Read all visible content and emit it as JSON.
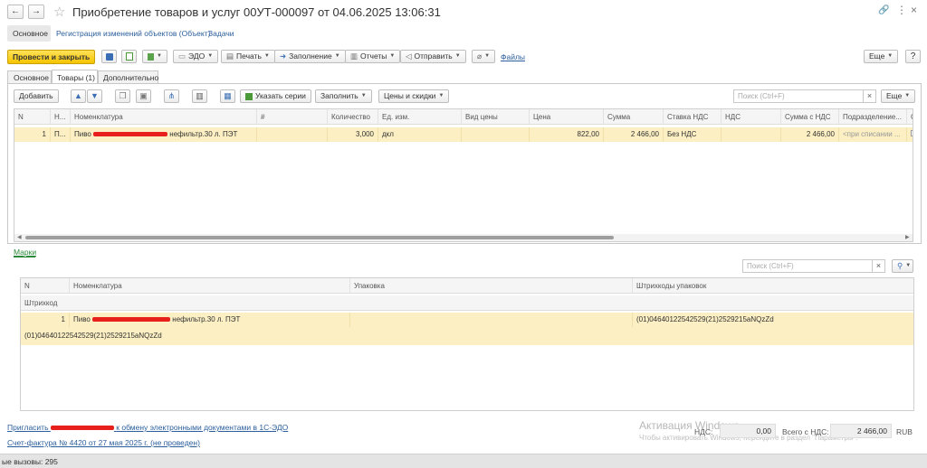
{
  "window": {
    "title": "Приобретение товаров и услуг 00УТ-000097 от 04.06.2025 13:06:31"
  },
  "nav_tabs": [
    "Основное",
    "Регистрация изменений объектов (Объект)",
    "Задачи"
  ],
  "toolbar": {
    "post_close": "Провести и закрыть",
    "edo": "ЭДО",
    "print": "Печать",
    "fill": "Заполнение",
    "reports": "Отчеты",
    "send": "Отправить",
    "files": "Файлы",
    "more": "Еще"
  },
  "form_tabs": [
    "Основное",
    "Товары (1)",
    "Дополнительно"
  ],
  "goods_toolbar": {
    "add": "Добавить",
    "specify_series": "Указать серии",
    "fill": "Заполнить",
    "prices": "Цены и скидки",
    "search_placeholder": "Поиск (Ctrl+F)",
    "more": "Еще"
  },
  "goods_table": {
    "headers": [
      "N",
      "Н...",
      "Номенклатура",
      "#",
      "Количество",
      "Ед. изм.",
      "Вид цены",
      "Цена",
      "Сумма",
      "Ставка НДС",
      "НДС",
      "Сумма с НДС",
      "Подразделение...",
      "С"
    ],
    "rows": [
      {
        "n": "1",
        "h": "П...",
        "nomenclature_prefix": "Пиво",
        "nomenclature_suffix": "нефильтр.30 л. ПЭТ",
        "qty": "3,000",
        "unit": "дкл",
        "price_type": "",
        "price": "822,00",
        "sum": "2 466,00",
        "vat_rate": "Без НДС",
        "vat": "",
        "sum_vat": "2 466,00",
        "division": "<при списании ..."
      }
    ]
  },
  "marks_link": "Марки",
  "marks_search_placeholder": "Поиск (Ctrl+F)",
  "marks_table": {
    "headers": [
      "N",
      "Номенклатура",
      "Упаковка",
      "Штрихкоды упаковок"
    ],
    "subheader": "Штрихкод",
    "row": {
      "n": "1",
      "nomenclature_prefix": "Пиво",
      "nomenclature_suffix": "нефильтр.30 л. ПЭТ",
      "pack_barcodes": "(01)04640122542529(21)2529215aNQzZd"
    },
    "barcode": "(01)04640122542529(21)2529215aNQzZd"
  },
  "footer": {
    "invite_prefix": "Пригласить",
    "invite_suffix": "к обмену электронными документами в 1С-ЭДО",
    "invoice": "Счет-фактура № 4420 от 27 мая 2025 г. (не проведен)",
    "vat_label": "НДС:",
    "vat_value": "0,00",
    "total_label": "Всего с НДС:",
    "total_value": "2 466,00",
    "currency": "RUB",
    "activation_title": "Активация Windows",
    "activation_text": "Чтобы активировать Windows, перейдите в раздел \"Параметры\"."
  },
  "status_bar": {
    "text": "ые вызовы: 295"
  }
}
